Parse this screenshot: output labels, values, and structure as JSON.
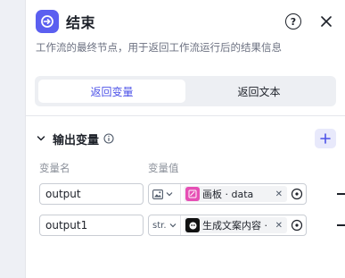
{
  "header": {
    "title": "结束",
    "node_icon": "end-node-icon",
    "help_label": "?",
    "close_icon": "close-icon"
  },
  "description": "工作流的最终节点，用于返回工作流运行后的结果信息",
  "segmented": {
    "options": [
      "返回变量",
      "返回文本"
    ],
    "selected": "返回变量"
  },
  "output_section": {
    "title": "输出变量",
    "columns": [
      "变量名",
      "变量值"
    ],
    "rows": [
      {
        "name": "output",
        "type_icon": "image-icon",
        "type_label": "",
        "ref_icon": "canvas-icon",
        "ref_text": "画板 · data",
        "remove": "remove-icon"
      },
      {
        "name": "output1",
        "type_icon": "",
        "type_label": "str.",
        "ref_icon": "ai-text-icon",
        "ref_text": "生成文案内容 ·",
        "remove": "remove-icon"
      }
    ]
  },
  "colors": {
    "accent": "#4d53e8",
    "node_icon_bg": "#5b5ff0",
    "canvas_tag_bg": "#e64fb5"
  }
}
